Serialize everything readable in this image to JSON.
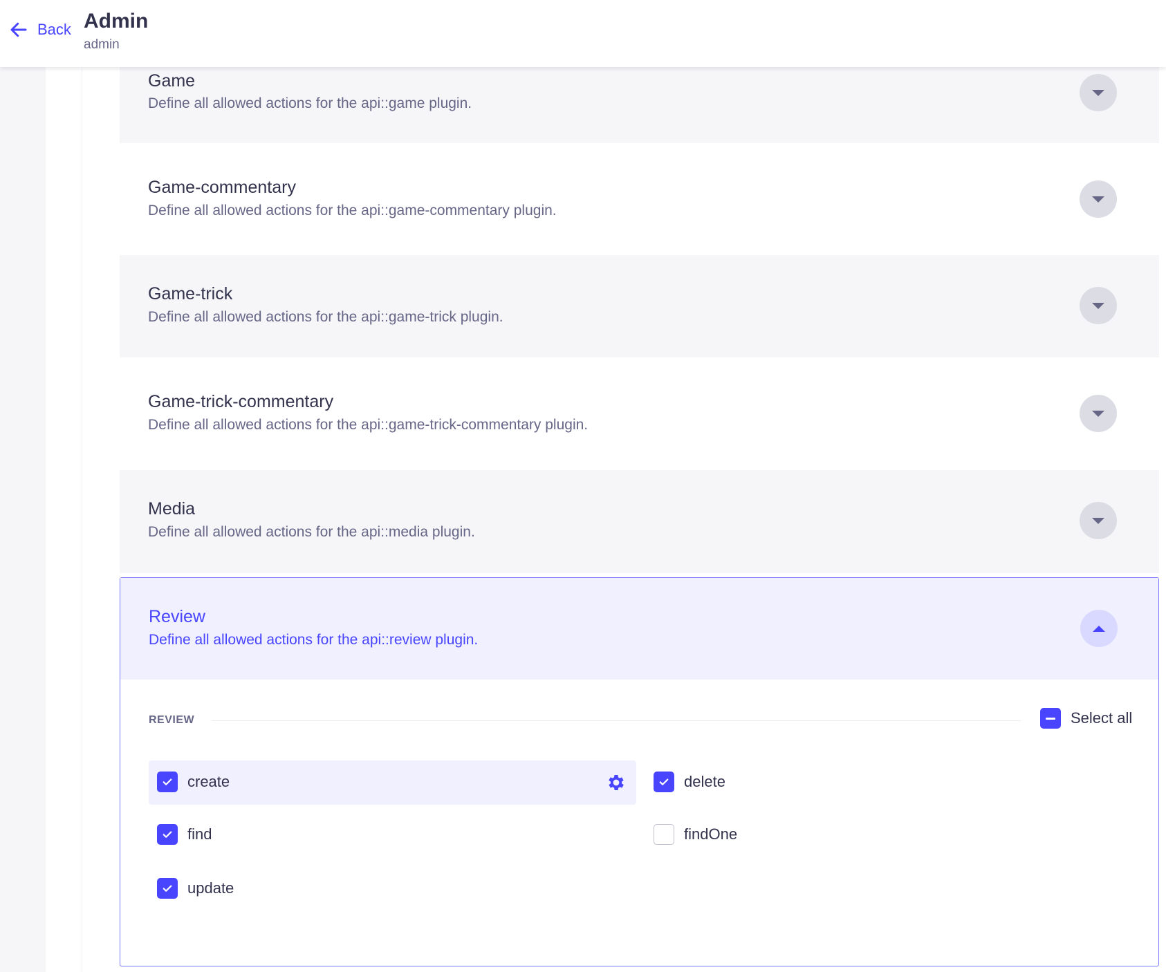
{
  "header": {
    "back_label": "Back",
    "title": "Admin",
    "subtitle": "admin"
  },
  "sections": [
    {
      "title": "Game",
      "description": "Define all allowed actions for the api::game plugin."
    },
    {
      "title": "Game-commentary",
      "description": "Define all allowed actions for the api::game-commentary plugin."
    },
    {
      "title": "Game-trick",
      "description": "Define all allowed actions for the api::game-trick plugin."
    },
    {
      "title": "Game-trick-commentary",
      "description": "Define all allowed actions for the api::game-trick-commentary plugin."
    },
    {
      "title": "Media",
      "description": "Define all allowed actions for the api::media plugin."
    }
  ],
  "review": {
    "title": "Review",
    "description": "Define all allowed actions for the api::review plugin.",
    "group_label": "REVIEW",
    "select_all_label": "Select all",
    "select_all_state": "indeterminate",
    "actions": [
      {
        "label": "create",
        "checked": true
      },
      {
        "label": "delete",
        "checked": true
      },
      {
        "label": "find",
        "checked": true
      },
      {
        "label": "findOne",
        "checked": false
      },
      {
        "label": "update",
        "checked": true
      }
    ]
  },
  "colors": {
    "primary": "#4945ff",
    "primary_light": "#f0f0ff",
    "neutral_bg": "#f6f6f9",
    "text": "#32324d",
    "text_muted": "#666687"
  },
  "icons": {
    "back": "arrow-left-icon",
    "toggle_closed": "caret-down-icon",
    "toggle_open": "caret-up-icon",
    "settings": "gear-icon",
    "check": "checkmark-icon"
  }
}
